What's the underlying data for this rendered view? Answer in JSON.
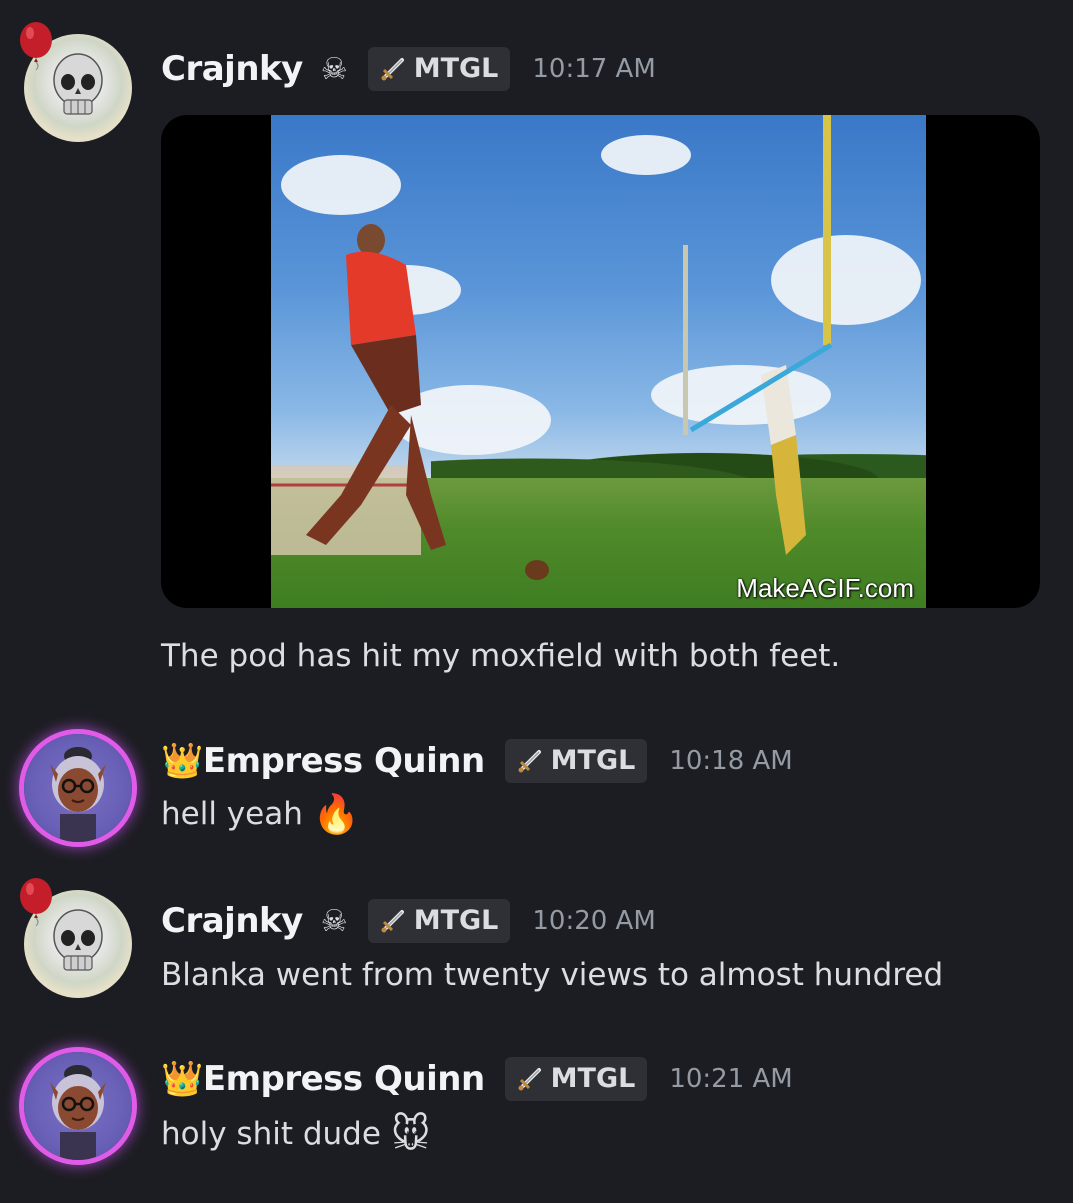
{
  "messages": [
    {
      "username": "Crajnky",
      "name_icon": "☠",
      "tag": "MTGL",
      "timestamp": "10:17 AM",
      "attachment": {
        "watermark": "MakeAGIF.com"
      },
      "text": "The pod has hit my moxfield with both feet."
    },
    {
      "username_prefix_icon": "👑",
      "username": "Empress Quinn",
      "tag": "MTGL",
      "timestamp": "10:18 AM",
      "text": "hell yeah",
      "emoji": "🔥"
    },
    {
      "username": "Crajnky",
      "name_icon": "☠",
      "tag": "MTGL",
      "timestamp": "10:20 AM",
      "text": "Blanka went from twenty views to almost hundred"
    },
    {
      "username_prefix_icon": "👑",
      "username": "Empress Quinn",
      "tag": "MTGL",
      "timestamp": "10:21 AM",
      "text": "holy shit dude",
      "emoji": "🐭"
    }
  ],
  "colors": {
    "background": "#1c1d22",
    "tag_background": "#2e3036",
    "timestamp": "#949ba4",
    "text": "#dbdee1",
    "avatar_ring": "#e05ce8"
  }
}
